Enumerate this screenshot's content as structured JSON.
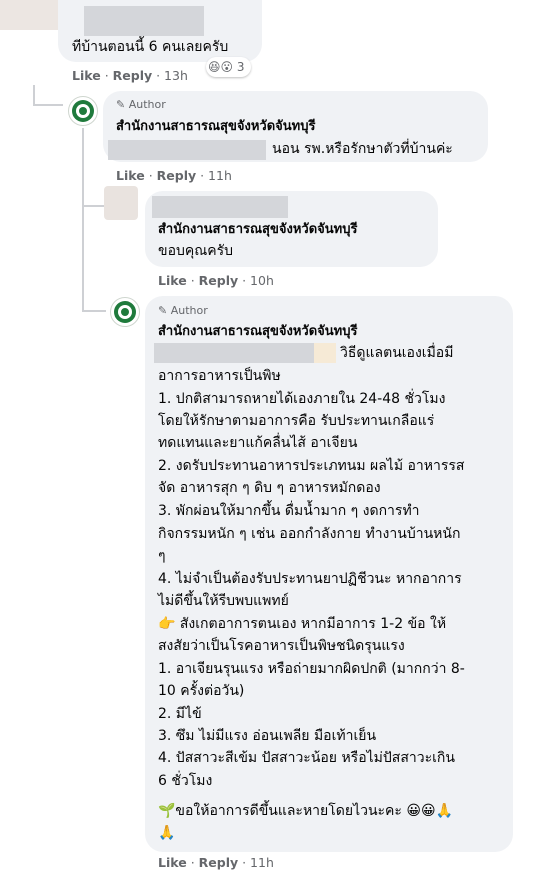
{
  "c1": {
    "text": "ทีบ้านตอนนี้ 6 คนเลยครับ",
    "like": "Like",
    "reply": "Reply",
    "time": "13h",
    "reaction_count": "3"
  },
  "c2": {
    "author_badge": "Author",
    "name": "สำนักงานสาธารณสุขจังหวัดจันทบุรี",
    "text": "นอน รพ.หรือรักษาตัวที่บ้านค่ะ",
    "like": "Like",
    "reply": "Reply",
    "time": "11h"
  },
  "c3": {
    "name": "สำนักงานสาธารณสุขจังหวัดจันทบุรี",
    "text": "ขอบคุณครับ",
    "like": "Like",
    "reply": "Reply",
    "time": "10h"
  },
  "c4": {
    "author_badge": "Author",
    "name": "สำนักงานสาธารณสุขจังหวัดจันทบุรี",
    "lines": [
      "วิธีดูแลตนเองเมื่อมี",
      "อาการอาหารเป็นพิษ",
      "1. ปกติสามารถหายได้เองภายใน 24-48 ชั่วโมง",
      "โดยให้รักษาตามอาการคือ รับประทานเกลือแร่",
      "ทดแทนและยาแก้คลื่นไส้ อาเจียน",
      "2. งดรับประทานอาหารประเภทนม ผลไม้ อาหารรส",
      "จัด อาหารสุก ๆ ดิบ ๆ อาหารหมักดอง",
      "3. พักผ่อนให้มากขึ้น ดื่มน้ำมาก ๆ งดการทำ",
      "กิจกรรมหนัก ๆ เช่น ออกกำลังกาย ทำงานบ้านหนัก",
      "ๆ",
      "4. ไม่จำเป็นต้องรับประทานยาปฏิชีวนะ หากอาการ",
      "ไม่ดีขึ้นให้รีบพบแพทย์",
      "👉 สังเกตอาการตนเอง หากมีอาการ 1-2 ข้อ ให้",
      "สงสัยว่าเป็นโรคอาหารเป็นพิษชนิดรุนแรง",
      "1. อาเจียนรุนแรง หรือถ่ายมากผิดปกติ (มากกว่า 8-",
      "10 ครั้งต่อวัน)",
      "2. มีไข้",
      "3. ซึม ไม่มีแรง อ่อนเพลีย มือเท้าเย็น",
      "4. ปัสสาวะสีเข้ม ปัสสาวะน้อย หรือไม่ปัสสาวะเกิน",
      "6 ชั่วโมง"
    ],
    "closing": "🌱ขอให้อาการดีขึ้นและหายโดยไวนะคะ 😀😀🙏",
    "closing2": "🙏",
    "like": "Like",
    "reply": "Reply",
    "time": "11h"
  }
}
